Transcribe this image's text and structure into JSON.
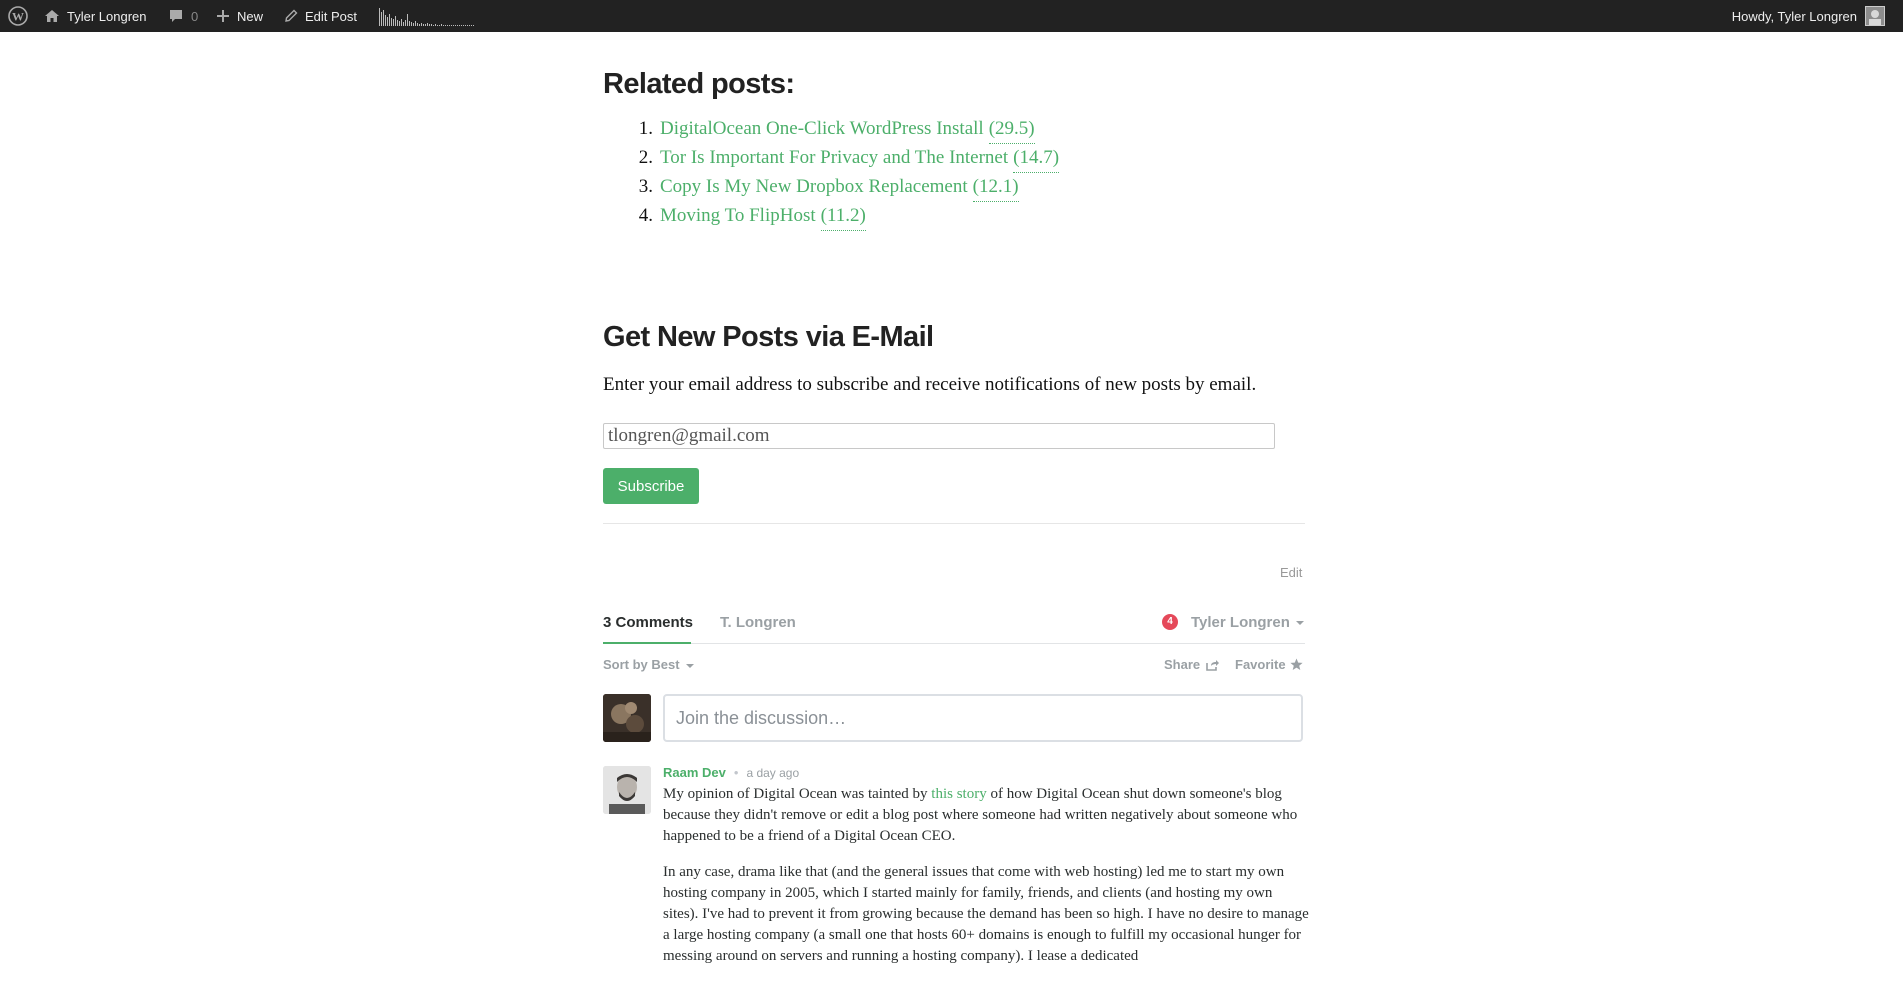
{
  "adminbar": {
    "site_name": "Tyler Longren",
    "comment_count": "0",
    "new_label": "New",
    "edit_label": "Edit Post",
    "howdy": "Howdy, Tyler Longren"
  },
  "related": {
    "heading": "Related posts:",
    "items": [
      {
        "num": "1.",
        "title": "DigitalOcean One-Click WordPress Install",
        "score": "(29.5)"
      },
      {
        "num": "2.",
        "title": "Tor Is Important For Privacy and The Internet",
        "score": "(14.7)"
      },
      {
        "num": "3.",
        "title": "Copy Is My New Dropbox Replacement",
        "score": "(12.1)"
      },
      {
        "num": "4.",
        "title": "Moving To FlipHost",
        "score": "(11.2)"
      }
    ]
  },
  "subscribe": {
    "heading": "Get New Posts via E-Mail",
    "intro": "Enter your email address to subscribe and receive notifications of new posts by email.",
    "email_value": "tlongren@gmail.com",
    "button_label": "Subscribe"
  },
  "edit_link": "Edit",
  "disqus": {
    "comments_tab": "3 Comments",
    "site_tab": "T. Longren",
    "notification_count": "4",
    "user_name": "Tyler Longren",
    "sort_label": "Sort by Best",
    "share_label": "Share",
    "favorite_label": "Favorite",
    "placeholder": "Join the discussion…",
    "accent_color": "#4caf6a",
    "comment": {
      "author": "Raam Dev",
      "separator": "•",
      "time": "a day ago",
      "p1_before": "My opinion of Digital Ocean was tainted by ",
      "p1_link": "this story",
      "p1_after": " of how Digital Ocean shut down someone's blog because they didn't remove or edit a blog post where someone had written negatively about someone who happened to be a friend of a Digital Ocean CEO.",
      "p2": "In any case, drama like that (and the general issues that come with web hosting) led me to start my own hosting company in 2005, which I started mainly for family, friends, and clients (and hosting my own sites). I've had to prevent it from growing because the demand has been so high. I have no desire to manage a large hosting company (a small one that hosts 60+ domains is enough to fulfill my occasional hunger for messing around on servers and running a hosting company). I lease a dedicated"
    }
  }
}
